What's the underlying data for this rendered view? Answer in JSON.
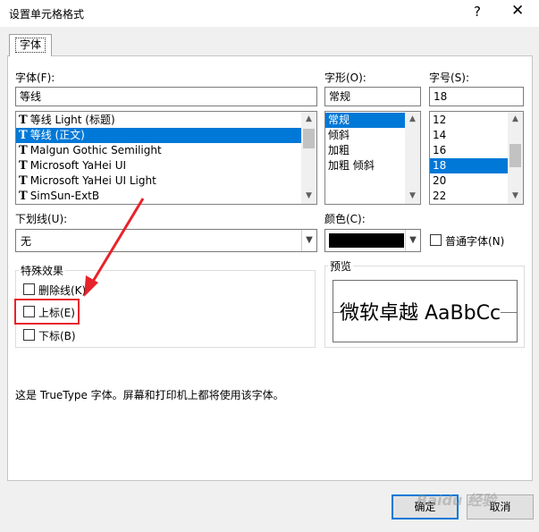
{
  "window": {
    "title": "设置单元格格式",
    "help": "?",
    "close": "✕"
  },
  "tab": {
    "label": "字体"
  },
  "font": {
    "label": "字体(F):",
    "value": "等线",
    "items": [
      {
        "icon": "T",
        "label": "等线 Light (标题)"
      },
      {
        "icon": "T",
        "label": "等线 (正文)"
      },
      {
        "icon": "T",
        "label": "Malgun Gothic Semilight"
      },
      {
        "icon": "T",
        "label": "Microsoft YaHei UI"
      },
      {
        "icon": "T",
        "label": "Microsoft YaHei UI Light"
      },
      {
        "icon": "T",
        "label": "SimSun-ExtB"
      }
    ],
    "selected_index": 1
  },
  "style": {
    "label": "字形(O):",
    "value": "常规",
    "items": [
      "常规",
      "倾斜",
      "加粗",
      "加粗 倾斜"
    ],
    "selected_index": 0
  },
  "size": {
    "label": "字号(S):",
    "value": "18",
    "items": [
      "12",
      "14",
      "16",
      "18",
      "20",
      "22"
    ],
    "selected_index": 3
  },
  "underline": {
    "label": "下划线(U):",
    "value": "无"
  },
  "color": {
    "label": "颜色(C):",
    "swatch": "#000000",
    "normal_font_label": "普通字体(N)"
  },
  "effects": {
    "title": "特殊效果",
    "strikethrough": "删除线(K)",
    "superscript": "上标(E)",
    "subscript": "下标(B)"
  },
  "preview": {
    "title": "预览",
    "text": "微软卓越  AaBbCc"
  },
  "info_text": "这是 TrueType 字体。屏幕和打印机上都将使用该字体。",
  "buttons": {
    "ok": "确定",
    "cancel": "取消"
  },
  "watermark": "Baidu 经验",
  "colors": {
    "accent": "#0078d7",
    "highlight": "#e8232a"
  }
}
